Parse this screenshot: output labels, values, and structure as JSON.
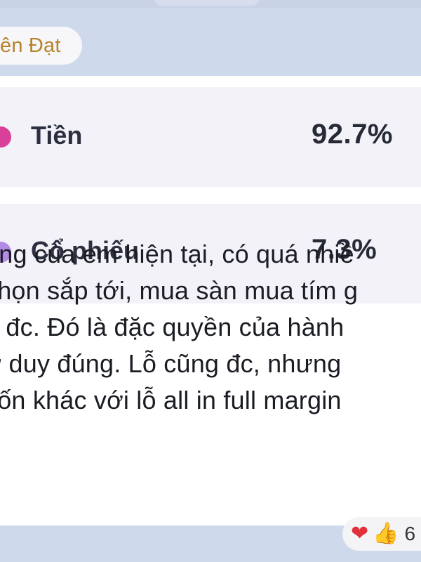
{
  "message": {
    "sender_name": "ên Đạt",
    "allocation": [
      {
        "label": "Tiền",
        "value": "92.7%",
        "color": "#d9409a"
      },
      {
        "label": "Cổ phiếu",
        "value": "7.3%",
        "color": "#b38ae6"
      }
    ],
    "text_lines": [
      "ọng của em hiện tại, có quá nhiề",
      "chọn sắp tới, mua sàn mua tím g",
      "g đc. Đó là đặc quyền của hành",
      "ư duy đúng. Lỗ cũng đc, nhưng",
      "vốn khác với lỗ all in full margin"
    ],
    "reactions": {
      "icons": [
        "heart-icon",
        "thumbs-up-icon"
      ],
      "count": "6"
    }
  }
}
